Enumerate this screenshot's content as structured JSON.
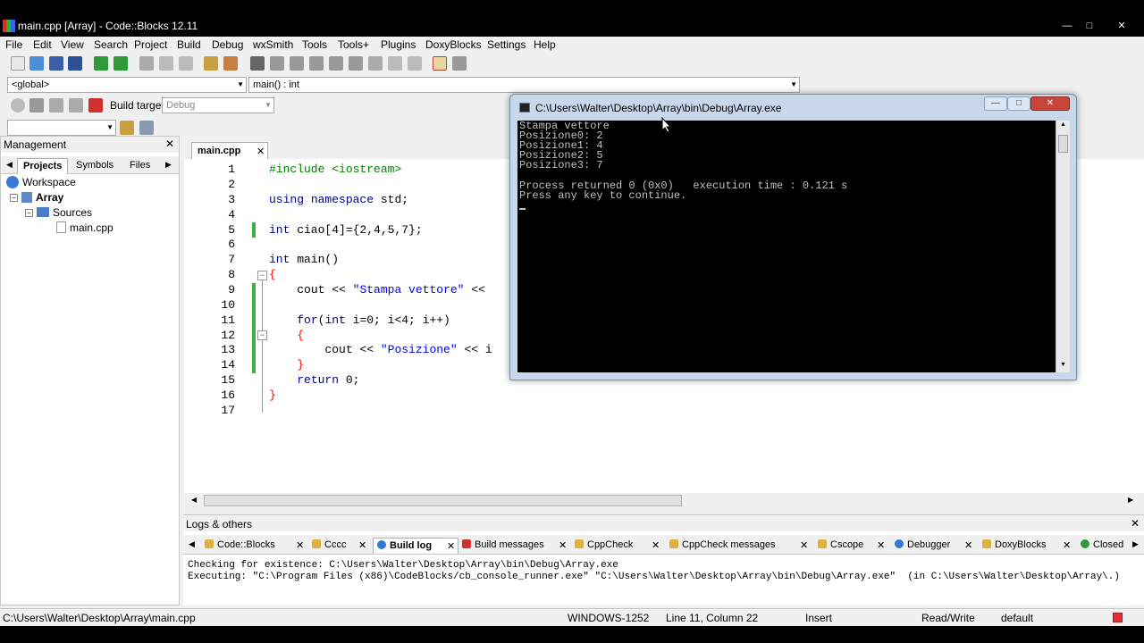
{
  "window": {
    "title": "main.cpp [Array] - Code::Blocks 12.11",
    "minimize": "—",
    "maximize": "□",
    "close": "✕"
  },
  "menu": [
    "File",
    "Edit",
    "View",
    "Search",
    "Project",
    "Build",
    "Debug",
    "wxSmith",
    "Tools",
    "Tools+",
    "Plugins",
    "DoxyBlocks",
    "Settings",
    "Help"
  ],
  "toolbar": {
    "scope_combo": "<global>",
    "function_combo": "main() : int",
    "build_target_label": "Build target:",
    "build_target_value": "Debug"
  },
  "management": {
    "title": "Management",
    "close": "✕",
    "tabs": [
      "Projects",
      "Symbols",
      "Files"
    ],
    "tree": {
      "workspace": "Workspace",
      "project": "Array",
      "folder": "Sources",
      "file": "main.cpp"
    }
  },
  "editor": {
    "tab_label": "main.cpp",
    "tab_close": "✕",
    "line_numbers": [
      "1",
      "2",
      "3",
      "4",
      "5",
      "6",
      "7",
      "8",
      "9",
      "10",
      "11",
      "12",
      "13",
      "14",
      "15",
      "16",
      "17"
    ],
    "lines": {
      "l1_pp": "#include <iostream>",
      "l3_kw1": "using",
      "l3_kw2": "namespace",
      "l3_rest": " std;",
      "l5_kw": "int",
      "l5_rest": " ciao[4]={2,4,5,7};",
      "l7_kw": "int",
      "l7_rest": " main()",
      "l8": "{",
      "l9_a": "cout << ",
      "l9_str": "\"Stampa vettore\"",
      "l9_b": " <<",
      "l11_kw1": "for",
      "l11_a": "(",
      "l11_kw2": "int",
      "l11_b": " i=0; i<4; i++)",
      "l12": "{",
      "l13_a": "cout << ",
      "l13_str": "\"Posizione\"",
      "l13_b": " << i",
      "l14": "}",
      "l15_kw": "return",
      "l15_rest": " 0;",
      "l16": "}"
    }
  },
  "console": {
    "title": "C:\\Users\\Walter\\Desktop\\Array\\bin\\Debug\\Array.exe",
    "lines": [
      "Stampa vettore",
      "Posizione0: 2",
      "Posizione1: 4",
      "Posizione2: 5",
      "Posizione3: 7",
      "",
      "Process returned 0 (0x0)   execution time : 0.121 s",
      "Press any key to continue."
    ]
  },
  "logs": {
    "title": "Logs & others",
    "close": "✕",
    "tabs": [
      "Code::Blocks",
      "Cccc",
      "Build log",
      "Build messages",
      "CppCheck",
      "CppCheck messages",
      "Cscope",
      "Debugger",
      "DoxyBlocks",
      "Closed"
    ],
    "tab_close": "✕",
    "lines": [
      "Checking for existence: C:\\Users\\Walter\\Desktop\\Array\\bin\\Debug\\Array.exe",
      "Executing: \"C:\\Program Files (x86)\\CodeBlocks/cb_console_runner.exe\" \"C:\\Users\\Walter\\Desktop\\Array\\bin\\Debug\\Array.exe\"  (in C:\\Users\\Walter\\Desktop\\Array\\.)"
    ]
  },
  "status": {
    "path": "C:\\Users\\Walter\\Desktop\\Array\\main.cpp",
    "encoding": "WINDOWS-1252",
    "position": "Line 11, Column 22",
    "mode": "Insert",
    "access": "Read/Write",
    "style": "default"
  },
  "colors": {
    "keyword": "#00008b",
    "preprocessor": "#008000",
    "string": "#0000ff",
    "change_marker": "#3cb043"
  }
}
